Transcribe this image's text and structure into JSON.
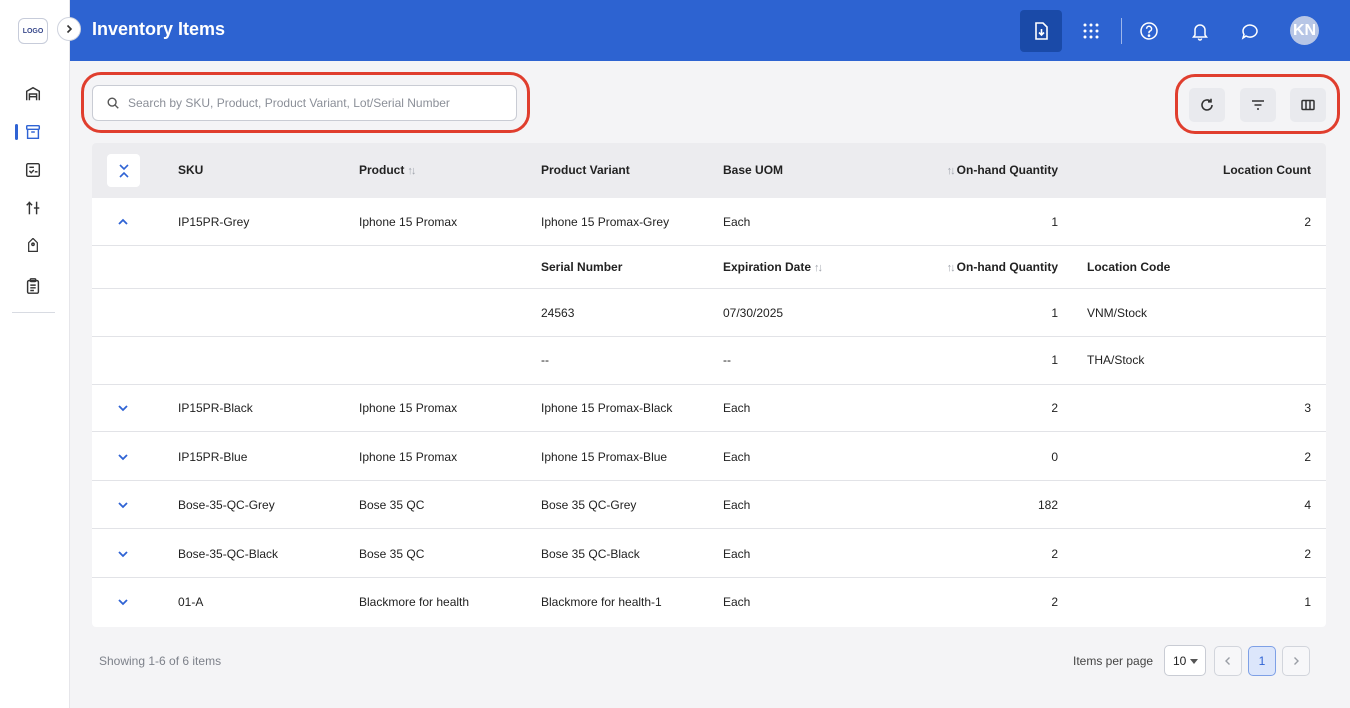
{
  "app": {
    "logo_text": "LOGO",
    "title": "Inventory Items",
    "avatar_initials": "KN"
  },
  "colors": {
    "header": "#2d63d1",
    "accent": "#2f63d4",
    "annotation_ring": "#e03e2e"
  },
  "sidebar": {
    "items": [
      {
        "icon": "warehouse-icon"
      },
      {
        "icon": "inventory-box-icon",
        "active": true
      },
      {
        "icon": "checklist-icon"
      },
      {
        "icon": "adjust-icon"
      },
      {
        "icon": "tag-icon"
      },
      {
        "icon": "clipboard-icon"
      }
    ]
  },
  "header_actions": [
    "download-icon",
    "apps-grid-icon",
    "help-icon",
    "bell-icon",
    "chat-icon"
  ],
  "search": {
    "placeholder": "Search by SKU, Product, Product Variant, Lot/Serial Number",
    "value": ""
  },
  "toolbar": [
    "refresh-icon",
    "filter-icon",
    "columns-icon"
  ],
  "table": {
    "headers": {
      "sku": "SKU",
      "product": "Product",
      "variant": "Product Variant",
      "uom": "Base UOM",
      "qty": "On-hand Quantity",
      "locations": "Location Count"
    },
    "expanded": {
      "sku": "IP15PR-Grey",
      "product": "Iphone 15 Promax",
      "variant": "Iphone 15 Promax-Grey",
      "uom": "Each",
      "qty": "1",
      "locations": "2",
      "sub_headers": {
        "serial": "Serial Number",
        "expiration": "Expiration Date",
        "qty": "On-hand Quantity",
        "location": "Location Code"
      },
      "sub_rows": [
        {
          "serial": "24563",
          "expiration": "07/30/2025",
          "qty": "1",
          "location": "VNM/Stock"
        },
        {
          "serial": "--",
          "expiration": "--",
          "qty": "1",
          "location": "THA/Stock"
        }
      ]
    },
    "rows": [
      {
        "sku": "IP15PR-Black",
        "product": "Iphone 15 Promax",
        "variant": "Iphone 15 Promax-Black",
        "uom": "Each",
        "qty": "2",
        "locations": "3"
      },
      {
        "sku": "IP15PR-Blue",
        "product": "Iphone 15 Promax",
        "variant": "Iphone 15 Promax-Blue",
        "uom": "Each",
        "qty": "0",
        "locations": "2"
      },
      {
        "sku": "Bose-35-QC-Grey",
        "product": "Bose 35 QC",
        "variant": "Bose 35 QC-Grey",
        "uom": "Each",
        "qty": "182",
        "locations": "4"
      },
      {
        "sku": "Bose-35-QC-Black",
        "product": "Bose 35 QC",
        "variant": "Bose 35 QC-Black",
        "uom": "Each",
        "qty": "2",
        "locations": "2"
      },
      {
        "sku": "01-A",
        "product": "Blackmore for health",
        "variant": "Blackmore for health-1",
        "uom": "Each",
        "qty": "2",
        "locations": "1"
      }
    ]
  },
  "footer": {
    "showing": "Showing 1-6 of 6 items",
    "items_per_page_label": "Items per page",
    "items_per_page": "10",
    "current_page": "1"
  }
}
